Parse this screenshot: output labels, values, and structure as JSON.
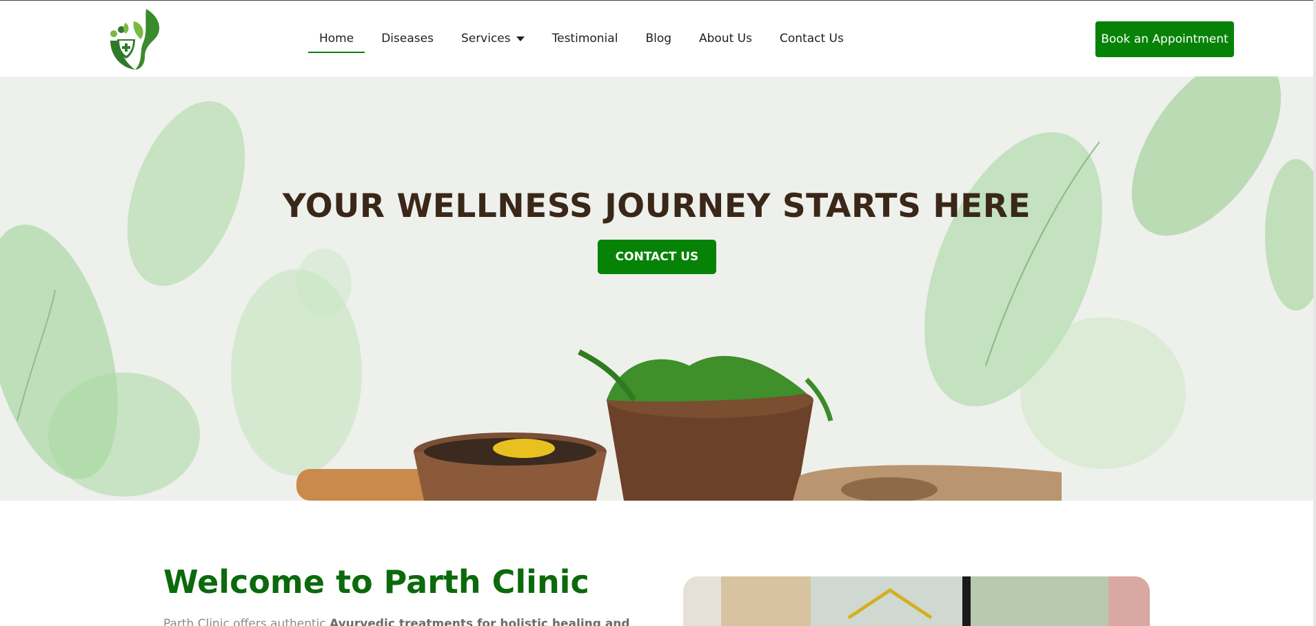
{
  "header": {
    "logo_name": "parth-clinic-logo",
    "nav": [
      {
        "label": "Home",
        "active": true
      },
      {
        "label": "Diseases"
      },
      {
        "label": "Services",
        "has_dropdown": true
      },
      {
        "label": "Testimonial"
      },
      {
        "label": "Blog"
      },
      {
        "label": "About Us"
      },
      {
        "label": "Contact Us"
      }
    ],
    "cta_label": "Book an Appointment"
  },
  "hero": {
    "title": "YOUR WELLNESS JOURNEY STARTS HERE",
    "button_label": "CONTACT US"
  },
  "welcome": {
    "title": "Welcome to Parth Clinic",
    "text_plain": "Parth Clinic offers authentic ",
    "text_bold": "Ayurvedic treatments for holistic healing and"
  },
  "colors": {
    "brand_green": "#068207",
    "heading_green": "#0b6a0b",
    "hero_title": "#3a2718"
  }
}
